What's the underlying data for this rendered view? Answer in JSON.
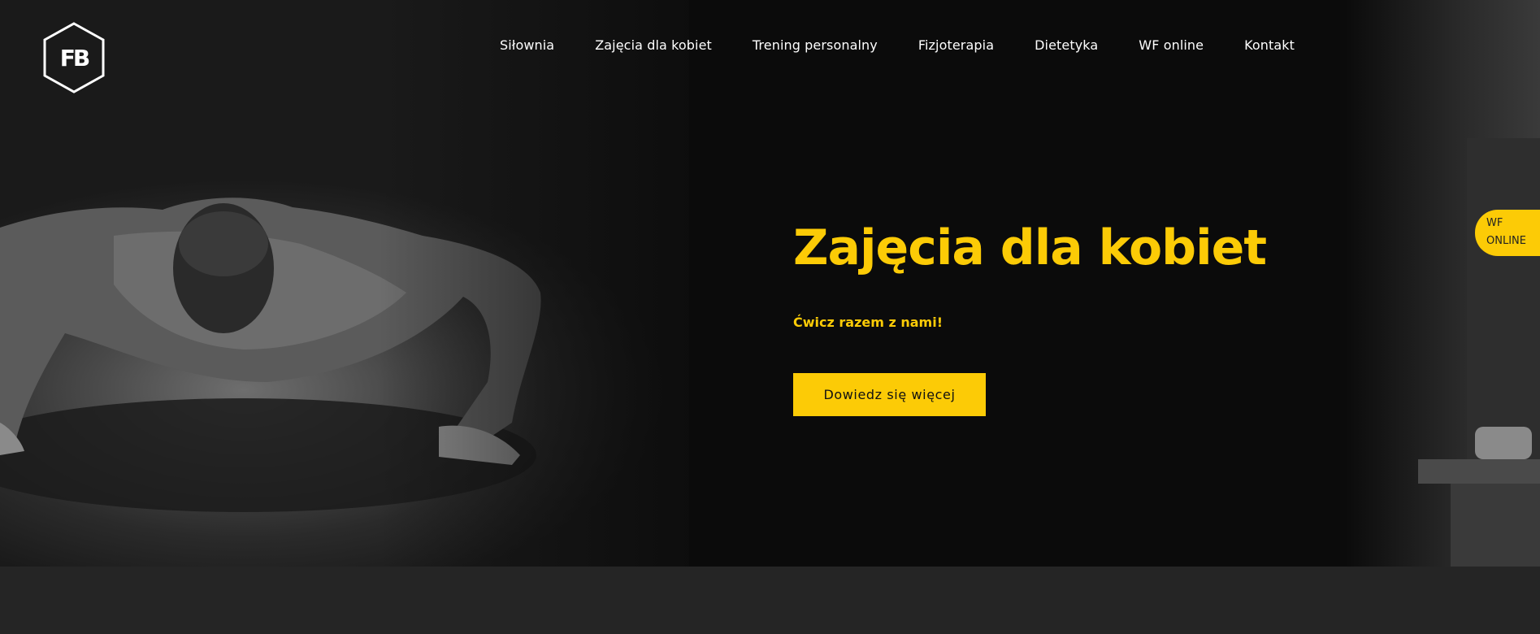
{
  "brand": {
    "logo_text": "FB",
    "logo_icon": "hexagon-fb-logo"
  },
  "nav": {
    "items": [
      {
        "label": "Siłownia"
      },
      {
        "label": "Zajęcia dla kobiet"
      },
      {
        "label": "Trening personalny"
      },
      {
        "label": "Fizjoterapia"
      },
      {
        "label": "Dietetyka"
      },
      {
        "label": "WF online"
      },
      {
        "label": "Kontakt"
      }
    ]
  },
  "hero": {
    "title": "Zajęcia dla kobiet",
    "subtitle": "Ćwicz razem z nami!",
    "cta_label": "Dowiedz się więcej",
    "image_icon": "pushup-photo"
  },
  "side_tab": {
    "label": "WF ONLINE"
  },
  "colors": {
    "accent": "#fccb06",
    "hero_bg": "#0b0b0b",
    "section_bg": "#252525",
    "nav_text": "#ffffff"
  }
}
